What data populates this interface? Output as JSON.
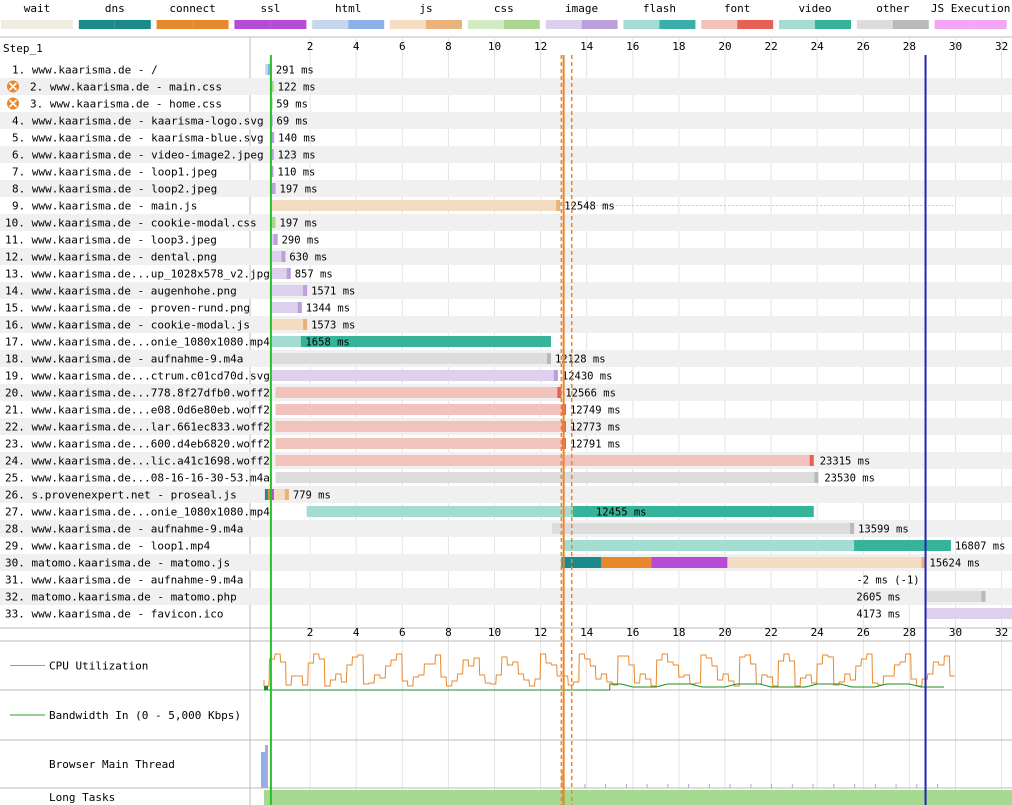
{
  "legend": [
    {
      "label": "wait",
      "c1": "#f0ecdf",
      "c2": "#f0ecdf"
    },
    {
      "label": "dns",
      "c1": "#1b8a8a",
      "c2": "#1b8a8a"
    },
    {
      "label": "connect",
      "c1": "#e8882c",
      "c2": "#e8882c"
    },
    {
      "label": "ssl",
      "c1": "#b84bd6",
      "c2": "#b84bd6"
    },
    {
      "label": "html",
      "c1": "#c6d6ee",
      "c2": "#8cb1e6"
    },
    {
      "label": "js",
      "c1": "#f3dcc2",
      "c2": "#e9b27a"
    },
    {
      "label": "css",
      "c1": "#d2ebc4",
      "c2": "#aad690"
    },
    {
      "label": "image",
      "c1": "#ddd0ec",
      "c2": "#bba0dc"
    },
    {
      "label": "flash",
      "c1": "#a6dbd5",
      "c2": "#3aafa9"
    },
    {
      "label": "font",
      "c1": "#f2c2bd",
      "c2": "#e66054"
    },
    {
      "label": "video",
      "c1": "#a3dcd0",
      "c2": "#35b49a"
    },
    {
      "label": "other",
      "c1": "#dcdcdc",
      "c2": "#b9b9b9"
    },
    {
      "label": "JS Execution",
      "c1": "#f4a6f4",
      "c2": "#f4a6f4"
    }
  ],
  "step_label": "Step_1",
  "x_ticks": [
    2,
    4,
    6,
    8,
    10,
    12,
    14,
    16,
    18,
    20,
    22,
    24,
    26,
    28,
    30,
    32
  ],
  "markers": [
    {
      "t": 0.3,
      "color": "#28c228",
      "style": "solid"
    },
    {
      "t": 12.9,
      "color": "#e8882c",
      "style": "dashed"
    },
    {
      "t": 13.0,
      "color": "#e8882c",
      "style": "solid"
    },
    {
      "t": 13.35,
      "color": "#e8882c",
      "style": "dashed"
    },
    {
      "t": 28.7,
      "color": "#2222bb",
      "style": "solid"
    }
  ],
  "requests": [
    {
      "label": "1. www.kaarisma.de - /",
      "start": 0.05,
      "end": 0.34,
      "type": "html",
      "ms": "291 ms",
      "blocked": false
    },
    {
      "label": "2. www.kaarisma.de - main.css",
      "start": 0.3,
      "end": 0.42,
      "type": "css",
      "ms": "122 ms",
      "blocked": true
    },
    {
      "label": "3. www.kaarisma.de - home.css",
      "start": 0.3,
      "end": 0.36,
      "type": "css",
      "ms": "59 ms",
      "blocked": true
    },
    {
      "label": "4. www.kaarisma.de - kaarisma-logo.svg",
      "start": 0.3,
      "end": 0.37,
      "type": "image",
      "ms": "69 ms",
      "blocked": false
    },
    {
      "label": "5. www.kaarisma.de - kaarisma-blue.svg",
      "start": 0.3,
      "end": 0.44,
      "type": "image",
      "ms": "140 ms",
      "blocked": false
    },
    {
      "label": "6. www.kaarisma.de - video-image2.jpeg",
      "start": 0.3,
      "end": 0.42,
      "type": "image",
      "ms": "123 ms",
      "blocked": false
    },
    {
      "label": "7. www.kaarisma.de - loop1.jpeg",
      "start": 0.3,
      "end": 0.41,
      "type": "image",
      "ms": "110 ms",
      "blocked": false
    },
    {
      "label": "8. www.kaarisma.de - loop2.jpeg",
      "start": 0.3,
      "end": 0.5,
      "type": "image",
      "ms": "197 ms",
      "blocked": false
    },
    {
      "label": "9. www.kaarisma.de - main.js",
      "start": 0.3,
      "end": 12.85,
      "type": "js",
      "ms": "12548 ms",
      "blocked": false,
      "jsexec": true
    },
    {
      "label": "10. www.kaarisma.de - cookie-modal.css",
      "start": 0.3,
      "end": 0.5,
      "type": "css",
      "ms": "197 ms",
      "blocked": false
    },
    {
      "label": "11. www.kaarisma.de - loop3.jpeg",
      "start": 0.3,
      "end": 0.59,
      "type": "image",
      "ms": "290 ms",
      "blocked": false
    },
    {
      "label": "12. www.kaarisma.de - dental.png",
      "start": 0.3,
      "end": 0.93,
      "type": "image",
      "ms": "630 ms",
      "blocked": false
    },
    {
      "label": "13. www.kaarisma.de...up_1028x578_v2.jpg",
      "start": 0.3,
      "end": 1.16,
      "type": "image",
      "ms": "857 ms",
      "blocked": false
    },
    {
      "label": "14. www.kaarisma.de - augenhohe.png",
      "start": 0.3,
      "end": 1.87,
      "type": "image",
      "ms": "1571 ms",
      "blocked": false
    },
    {
      "label": "15. www.kaarisma.de - proven-rund.png",
      "start": 0.3,
      "end": 1.64,
      "type": "image",
      "ms": "1344 ms",
      "blocked": false
    },
    {
      "label": "16. www.kaarisma.de - cookie-modal.js",
      "start": 0.3,
      "end": 1.87,
      "type": "js",
      "ms": "1573 ms",
      "blocked": false
    },
    {
      "label": "17. www.kaarisma.de...onie_1080x1080.mp4",
      "start": 0.3,
      "end": 12.45,
      "type": "video",
      "ms": "1658 ms",
      "blocked": false,
      "darkFrom": 1.6,
      "inside": true
    },
    {
      "label": "18. www.kaarisma.de - aufnahme-9.m4a",
      "start": 0.3,
      "end": 12.45,
      "type": "other",
      "ms": "12128 ms",
      "blocked": false
    },
    {
      "label": "19. www.kaarisma.de...ctrum.c01cd70d.svg",
      "start": 0.3,
      "end": 12.75,
      "type": "image",
      "ms": "12430 ms",
      "blocked": false
    },
    {
      "label": "20. www.kaarisma.de...778.8f27dfb0.woff2",
      "start": 0.5,
      "end": 12.9,
      "type": "font",
      "ms": "12566 ms",
      "blocked": false
    },
    {
      "label": "21. www.kaarisma.de...e08.0d6e80eb.woff2",
      "start": 0.5,
      "end": 13.1,
      "type": "font",
      "ms": "12749 ms",
      "blocked": false
    },
    {
      "label": "22. www.kaarisma.de...lar.661ec833.woff2",
      "start": 0.5,
      "end": 13.1,
      "type": "font",
      "ms": "12773 ms",
      "blocked": false
    },
    {
      "label": "23. www.kaarisma.de...600.d4eb6820.woff2",
      "start": 0.5,
      "end": 13.1,
      "type": "font",
      "ms": "12791 ms",
      "blocked": false
    },
    {
      "label": "24. www.kaarisma.de...lic.a41c1698.woff2",
      "start": 0.5,
      "end": 23.85,
      "type": "font",
      "ms": "23315 ms",
      "blocked": false
    },
    {
      "label": "25. www.kaarisma.de...08-16-16-30-53.m4a",
      "start": 0.5,
      "end": 24.05,
      "type": "other",
      "ms": "23530 ms",
      "blocked": false
    },
    {
      "label": "26. s.provenexpert.net - proseal.js",
      "start": 0.3,
      "end": 1.08,
      "type": "js",
      "ms": "779 ms",
      "blocked": false,
      "conn": true
    },
    {
      "label": "27. www.kaarisma.de...onie_1080x1080.mp4",
      "start": 1.85,
      "end": 23.85,
      "type": "video",
      "ms": "12455 ms",
      "blocked": false,
      "darkFrom": 13.4,
      "inside": true,
      "light2": [
        25.3,
        25.4
      ]
    },
    {
      "label": "28. www.kaarisma.de - aufnahme-9.m4a",
      "start": 12.5,
      "end": 25.6,
      "type": "other",
      "ms": "13599 ms",
      "blocked": false
    },
    {
      "label": "29. www.kaarisma.de - loop1.mp4",
      "start": 13.0,
      "end": 29.8,
      "type": "video",
      "ms": "16807 ms",
      "blocked": false,
      "darkFrom": 25.6
    },
    {
      "label": "30. matomo.kaarisma.de - matomo.js",
      "start": 12.9,
      "end": 28.7,
      "type": "js",
      "ms": "15624 ms",
      "blocked": false,
      "conn3": true
    },
    {
      "label": "31. www.kaarisma.de - aufnahme-9.m4a",
      "start": null,
      "end": null,
      "type": "other",
      "ms": "-2 ms (-1)",
      "blocked": false,
      "textAt": 25.7
    },
    {
      "label": "32. matomo.kaarisma.de - matomo.php",
      "start": 28.7,
      "end": 31.3,
      "type": "other",
      "ms": "2605 ms",
      "blocked": false,
      "textAt": 25.7
    },
    {
      "label": "33. www.kaarisma.de - favicon.ico",
      "start": 28.7,
      "end": 32.9,
      "type": "image",
      "ms": "4173 ms",
      "blocked": false,
      "textAt": 25.7
    }
  ],
  "panels": [
    {
      "label": "CPU Utilization",
      "swatch": "#e8882c"
    },
    {
      "label": "Bandwidth In (0 - 5,000 Kbps)",
      "swatch": "#28a028"
    },
    {
      "label": "Browser Main Thread",
      "swatch": null
    },
    {
      "label": "Long Tasks",
      "swatch": null
    }
  ]
}
